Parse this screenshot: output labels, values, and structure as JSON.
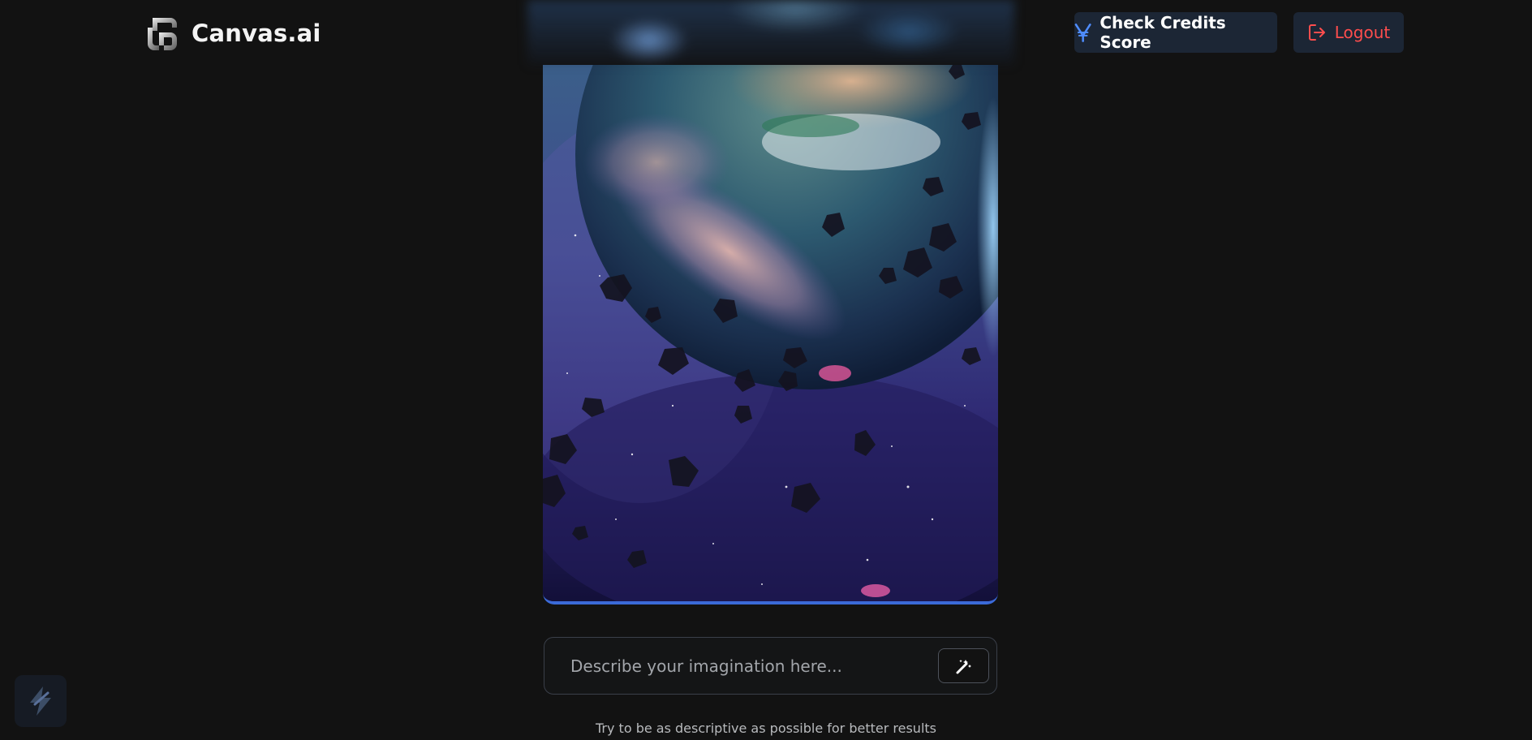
{
  "app": {
    "name": "Canvas.ai",
    "logo_icon": "canvas-logo-icon"
  },
  "header": {
    "credits_button": {
      "label": "Check Credits Score",
      "icon": "credits-icon",
      "color": "#ffffff",
      "icon_color": "#4f8dff"
    },
    "logout_button": {
      "label": "Logout",
      "icon": "logout-icon",
      "color": "#ff4d4d"
    }
  },
  "generated_image": {
    "description_icon": "generated-image",
    "accent_bar_color": "#3b6ad8"
  },
  "prompt": {
    "placeholder": "Describe your imagination here...",
    "value": "",
    "generate_icon": "magic-wand-icon"
  },
  "hint": {
    "text": "Try to be as descriptive as possible for better results"
  },
  "corner_widget": {
    "icon": "stackblitz-bolt-icon"
  }
}
